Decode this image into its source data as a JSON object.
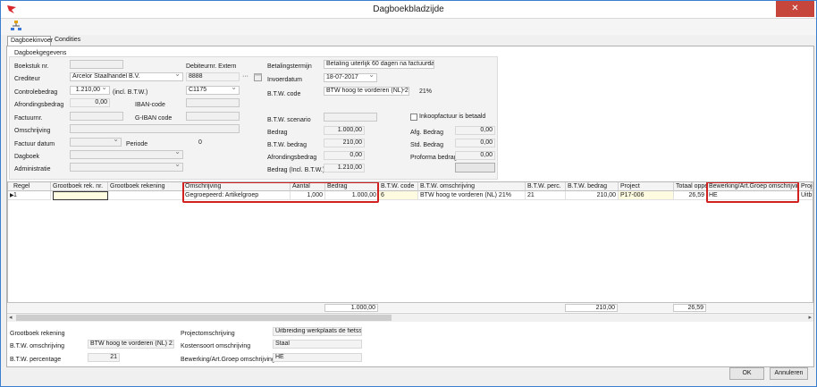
{
  "window": {
    "title": "Dagboekbladzijde",
    "close": "✕"
  },
  "tabs": [
    {
      "label": "Dagboekinvoer"
    },
    {
      "label": "Condities"
    }
  ],
  "group": {
    "title": "Dagboekgegevens",
    "boekstuk": {
      "label": "Boekstuk nr.",
      "value": ""
    },
    "crediteur": {
      "label": "Crediteur",
      "value": "Arcelor Staalhandel B.V."
    },
    "controlebedrag": {
      "label": "Controlebedrag",
      "value": "1.210,00",
      "suffix": "(incl. B.T.W.)"
    },
    "afrondingsbedrag": {
      "label": "Afrondingsbedrag",
      "value": "0,00"
    },
    "factuurnr": {
      "label": "Factuurnr.",
      "value": ""
    },
    "omschrijving": {
      "label": "Omschrijving",
      "value": ""
    },
    "factuurdatum": {
      "label": "Factuur datum",
      "value": ""
    },
    "periode": {
      "label": "Periode",
      "value": "0"
    },
    "dagboek": {
      "label": "Dagboek",
      "value": ""
    },
    "administratie": {
      "label": "Administratie",
      "value": ""
    },
    "debiteurnr": {
      "label": "Debiteurnr. Extern",
      "value": "8888",
      "ellipsis": "···"
    },
    "code": {
      "value": "C1175"
    },
    "iban": {
      "label": "IBAN-code",
      "value": ""
    },
    "giban": {
      "label": "G-IBAN code",
      "value": ""
    },
    "betalingstermijn": {
      "label": "Betalingstermijn",
      "value": "Betaling uiterlijk 60 dagen na factuurda"
    },
    "invoerdatum": {
      "label": "Invoerdatum",
      "value": "18-07-2017"
    },
    "btwcode": {
      "label": "B.T.W. code",
      "value": "BTW hoog te vorderen (NL) 21",
      "percent": "21%"
    },
    "btwscenario": {
      "label": "B.T.W. scenario",
      "value": ""
    },
    "bedrag": {
      "label": "Bedrag",
      "value": "1.000,00"
    },
    "btwbedrag": {
      "label": "B.T.W. bedrag",
      "value": "210,00"
    },
    "afrondingsbedrag2": {
      "label": "Afrondingsbedrag",
      "value": "0,00"
    },
    "bedragincl": {
      "label": "Bedrag (Incl. B.T.W.)",
      "value": "1.210,00"
    },
    "inkoopfactuur": {
      "label": "Inkoopfactuur is betaald"
    },
    "afgbedrag": {
      "label": "Afg. Bedrag",
      "value": "0,00"
    },
    "stdbedrag": {
      "label": "Std. Bedrag",
      "value": "0,00"
    },
    "proformabedrag": {
      "label": "Proforma bedrag",
      "value": "0,00"
    }
  },
  "grid": {
    "headers": [
      "Regel",
      "Grootboek rek. nr.",
      "Grootboek rekening",
      "Omschrijving",
      "Aantal",
      "Bedrag",
      "B.T.W. code",
      "B.T.W. omschrijving",
      "B.T.W. perc.",
      "B.T.W. bedrag",
      "Project",
      "Totaal opper",
      "Bewerking/Art.Groep omschrijving",
      "Proje"
    ],
    "row": [
      "1",
      "",
      "",
      "Gegroepeerd: Artikelgroep",
      "1,000",
      "1.000,00",
      "6",
      "BTW hoog te vorderen (NL) 21%",
      "21",
      "210,00",
      "P17-006",
      "26,59",
      "HE",
      "Uitbre"
    ],
    "totals": {
      "bedrag": "1.000,00",
      "btwbedrag": "210,00",
      "opper": "26,59"
    }
  },
  "bottom": {
    "grootboek": {
      "label": "Grootboek rekening",
      "value": ""
    },
    "btwomschrijving": {
      "label": "B.T.W. omschrijving",
      "value": "BTW hoog te vorderen (NL) 21%"
    },
    "btwpercentage": {
      "label": "B.T.W. percentage",
      "value": "21"
    },
    "projectomschrijving": {
      "label": "Projectomschrijving",
      "value": "Uitbreiding werkplaats de fietsspe"
    },
    "kostensoort": {
      "label": "Kostensoort omschrijving",
      "value": "Staal"
    },
    "bewerking": {
      "label": "Bewerking/Art.Groep omschrijving",
      "value": "HE"
    }
  },
  "buttons": {
    "ok": "OK",
    "annuleren": "Annuleren"
  }
}
